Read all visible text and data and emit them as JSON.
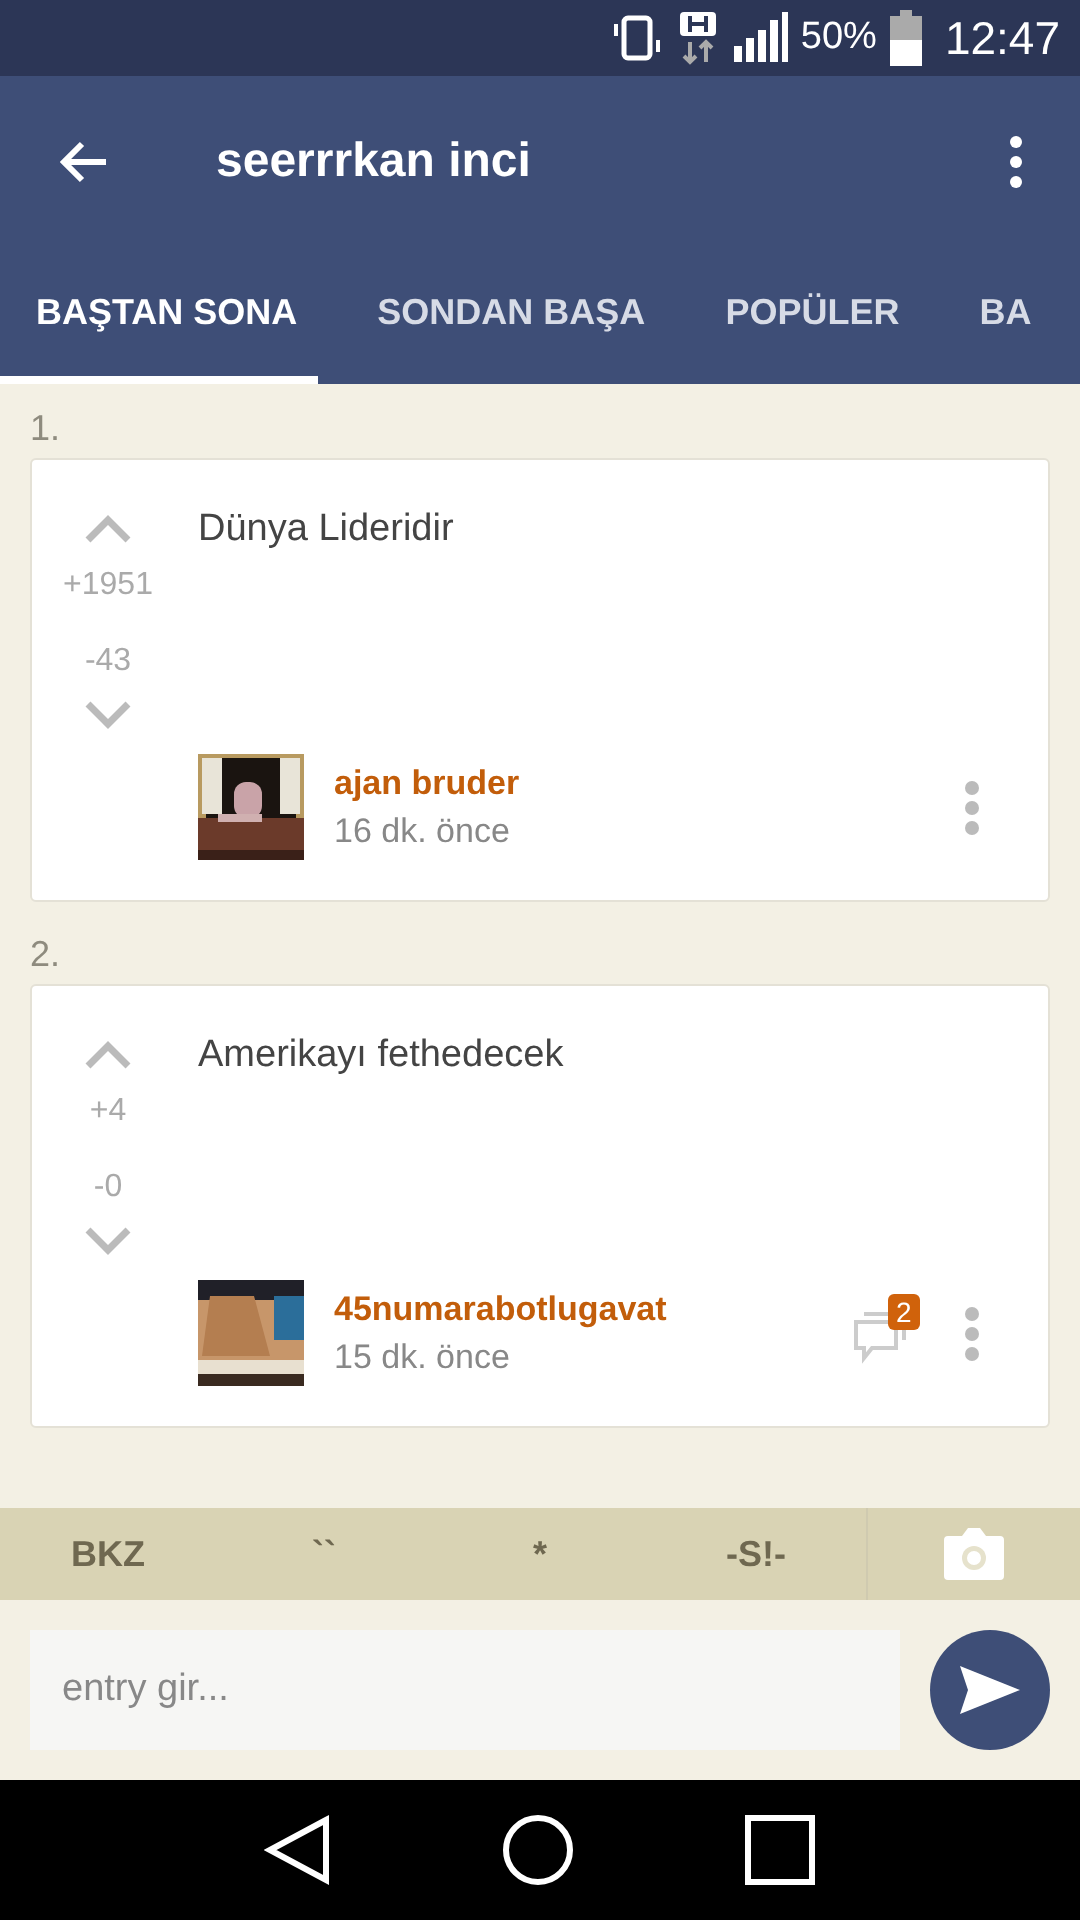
{
  "status_bar": {
    "battery": "50%",
    "time": "12:47"
  },
  "app_bar": {
    "title": "seerrrkan inci"
  },
  "tabs": [
    {
      "label": "BAŞTAN SONA",
      "selected": true
    },
    {
      "label": "SONDAN BAŞA",
      "selected": false
    },
    {
      "label": "POPÜLER",
      "selected": false
    },
    {
      "label": "BA",
      "selected": false
    }
  ],
  "entries": [
    {
      "number": "1.",
      "text": "Dünya Lideridir",
      "upvotes": "+1951",
      "downvotes": "-43",
      "author": "ajan bruder",
      "time": "16 dk. önce"
    },
    {
      "number": "2.",
      "text": "Amerikayı fethedecek",
      "upvotes": "+4",
      "downvotes": "-0",
      "author": "45numarabotlugavat",
      "time": "15 dk. önce",
      "comments": "2"
    }
  ],
  "format_bar": [
    "BKZ",
    "``",
    "*",
    "-S!-"
  ],
  "composer": {
    "placeholder": "entry gir..."
  }
}
